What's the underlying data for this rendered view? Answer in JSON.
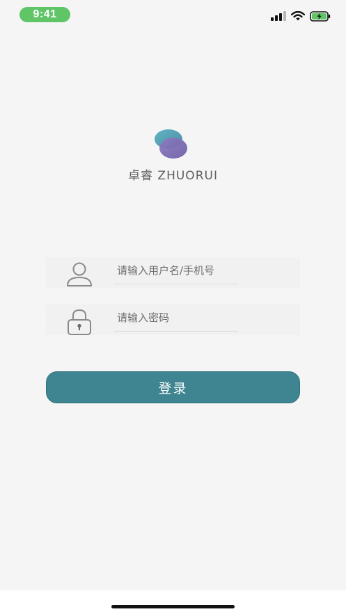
{
  "status_bar": {
    "time": "9:41",
    "signal_icon": "cellular-signal-icon",
    "wifi_icon": "wifi-icon",
    "battery_icon": "battery-charging-icon"
  },
  "brand": {
    "name": "卓睿 ZHUORUI",
    "logo_icon": "app-logo-icon"
  },
  "login_form": {
    "username_placeholder": "请输入用户名/手机号",
    "username_icon": "user-icon",
    "password_placeholder": "请输入密码",
    "password_icon": "lock-icon",
    "submit_label": "登录"
  },
  "colors": {
    "accent": "#3e8591",
    "background": "#f5f5f5",
    "time_pill": "#5fc567"
  }
}
